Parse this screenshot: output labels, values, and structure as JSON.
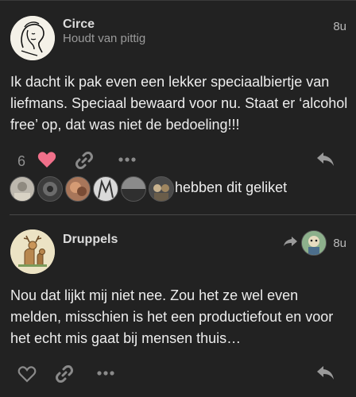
{
  "post1": {
    "author": "Circe",
    "subtitle": "Houdt van pittig",
    "time": "8u",
    "text": "Ik dacht ik pak even een lekker speciaalbiertje van liefmans. Speciaal bewaard voor nu. Staat er ‘alcohol free’ op, dat was niet de bedoeling!!!",
    "like_count": "6",
    "liked_by_text": "hebben dit geliket",
    "icons": [
      "heart-icon",
      "link-icon",
      "more-icon",
      "reply-icon"
    ],
    "liker_avatars": [
      "avatar-1",
      "avatar-2",
      "avatar-3",
      "avatar-4",
      "avatar-5",
      "avatar-6"
    ]
  },
  "post2": {
    "author": "Druppels",
    "time": "8u",
    "text": "Nou dat lijkt mij niet nee. Zou het ze wel even melden, misschien is het een productiefout en voor het echt mis gaat bij mensen thuis…",
    "icons": [
      "heart-outline-icon",
      "link-icon",
      "more-icon",
      "reply-icon",
      "reply-to-icon"
    ]
  },
  "colors": {
    "background": "#222222",
    "heart": "#f0708a",
    "text": "#ededed",
    "muted": "#9a9a9a"
  }
}
